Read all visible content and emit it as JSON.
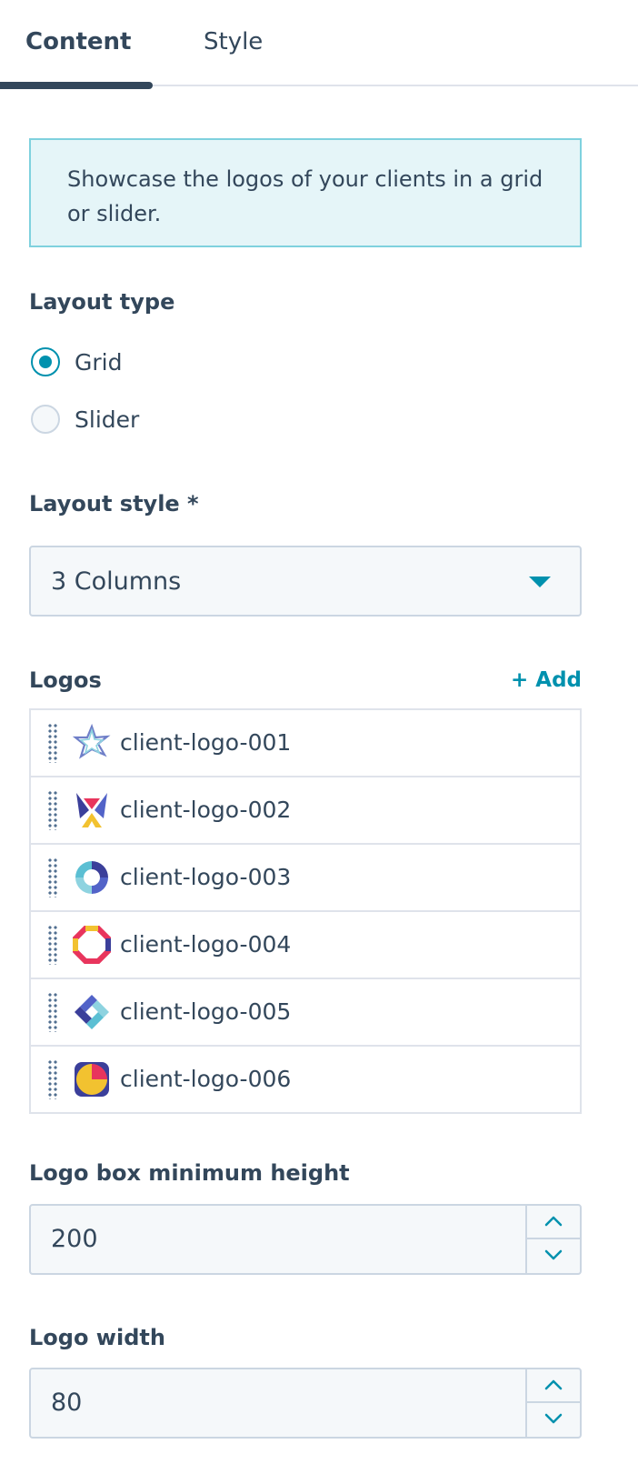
{
  "tabs": [
    {
      "label": "Content",
      "active": true
    },
    {
      "label": "Style",
      "active": false
    }
  ],
  "info_text": "Showcase the logos of your clients in a grid or slider.",
  "layout_type": {
    "label": "Layout type",
    "options": [
      {
        "label": "Grid",
        "checked": true
      },
      {
        "label": "Slider",
        "checked": false
      }
    ]
  },
  "layout_style": {
    "label": "Layout style *",
    "value": "3 Columns"
  },
  "logos": {
    "label": "Logos",
    "add_label": "+ Add",
    "items": [
      {
        "name": "client-logo-001",
        "icon": "star-outline-logo-icon"
      },
      {
        "name": "client-logo-002",
        "icon": "x-mark-logo-icon"
      },
      {
        "name": "client-logo-003",
        "icon": "ring-logo-icon"
      },
      {
        "name": "client-logo-004",
        "icon": "octagon-ring-logo-icon"
      },
      {
        "name": "client-logo-005",
        "icon": "diamond-chevrons-logo-icon"
      },
      {
        "name": "client-logo-006",
        "icon": "quatrefoil-logo-icon"
      }
    ]
  },
  "logo_box_min_height": {
    "label": "Logo box minimum height",
    "value": "200"
  },
  "logo_width": {
    "label": "Logo width",
    "value": "80"
  },
  "colors": {
    "accent": "#0091ae",
    "text": "#33475b",
    "info_bg": "#e5f5f8",
    "info_border": "#7fd1de",
    "field_bg": "#f5f8fa",
    "border": "#cbd6e2"
  }
}
